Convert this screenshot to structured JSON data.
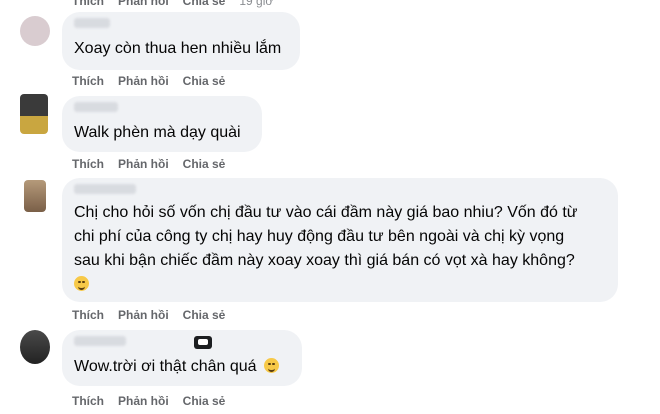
{
  "actions": {
    "like": "Thích",
    "reply": "Phản hồi",
    "share": "Chia sẻ"
  },
  "comments": [
    {
      "text": "",
      "time": "19 giờ"
    },
    {
      "text": "Xoay còn thua hen nhiều lắm"
    },
    {
      "text": "Walk phèn mà dạy quài"
    },
    {
      "lines": [
        "Chị cho hỏi số vốn chị đầu tư vào cái đầm này giá bao nhiu? Vốn đó từ",
        "chi phí của công ty chị hay huy động đầu tư bên ngoài và chị kỳ vọng",
        "sau khi bận chiếc đầm này xoay xoay thì giá bán có vọt xà hay không?"
      ],
      "emoji": "face-with-sweat-icon"
    },
    {
      "text": "Wow.trời ơi thật chân quá",
      "emoji": "rolling-laughing-icon"
    }
  ],
  "colors": {
    "bubble": "#f0f2f5",
    "action_text": "#65676b",
    "text": "#050505"
  }
}
